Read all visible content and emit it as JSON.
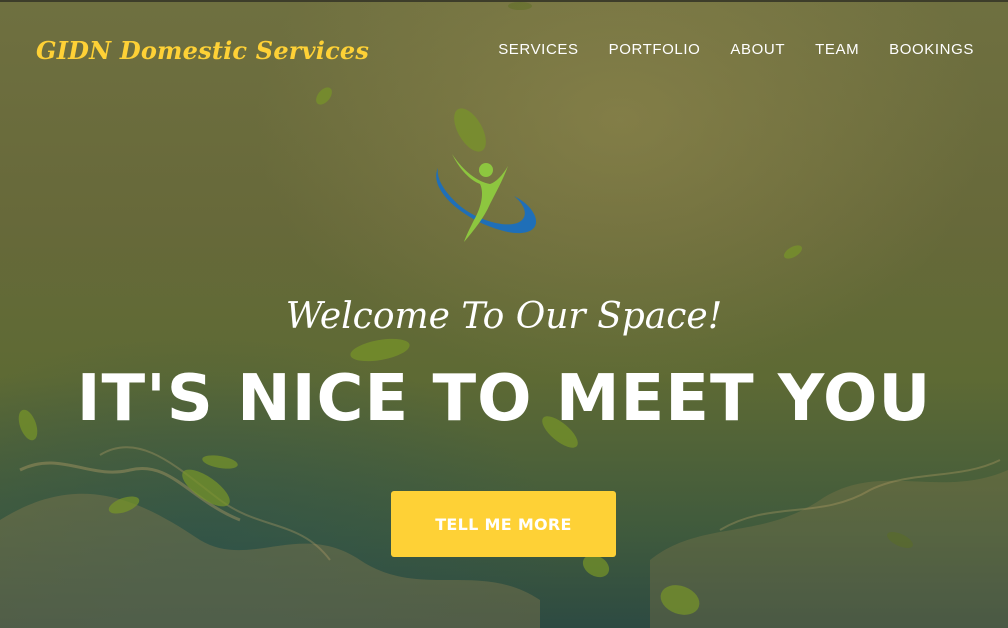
{
  "brand": {
    "name": "GIDN Domestic Services",
    "color": "#fed136"
  },
  "nav": {
    "items": [
      {
        "label": "SERVICES"
      },
      {
        "label": "PORTFOLIO"
      },
      {
        "label": "ABOUT"
      },
      {
        "label": "TEAM"
      },
      {
        "label": "BOOKINGS"
      }
    ]
  },
  "hero": {
    "logo_icon": "person-swoosh-logo-icon",
    "lead": "Welcome To Our Space!",
    "heading": "IT'S NICE TO MEET YOU",
    "cta_label": "TELL ME MORE",
    "background_icon": "leaves-water-splash-background"
  },
  "colors": {
    "accent": "#fed136",
    "logo_green": "#8dc63f",
    "logo_blue": "#1f6fb8",
    "text": "#ffffff"
  }
}
